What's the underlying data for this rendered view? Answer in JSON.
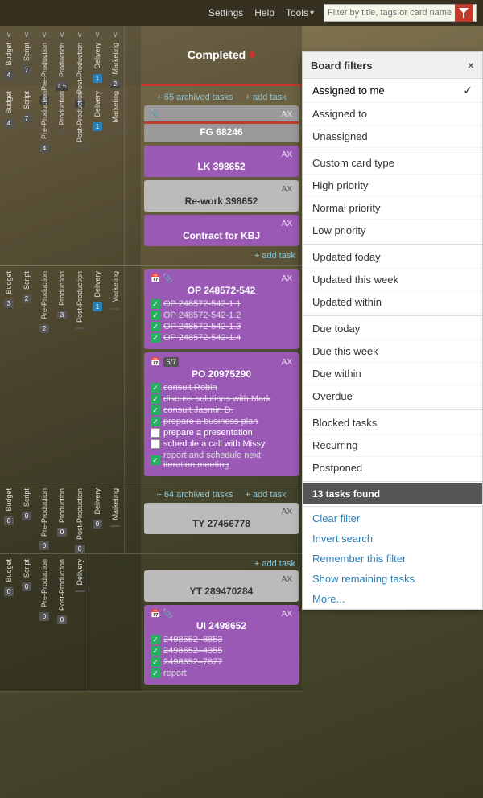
{
  "topbar": {
    "settings": "Settings",
    "help": "Help",
    "tools": "Tools",
    "tools_arrow": "▾",
    "search_placeholder": "Filter by title, tags or card name"
  },
  "board": {
    "completed_label": "Completed",
    "archived_tasks_1": "+ 65 archived tasks",
    "add_task_1": "+ add task",
    "archived_tasks_2": "+ 64 archived tasks",
    "add_task_2": "+ add task",
    "add_task_3": "+ add task",
    "cards": [
      {
        "id": "card-fg",
        "title": "FG 68246",
        "color": "grey",
        "ax": "AX",
        "has_clip": true,
        "has_red_line": true
      },
      {
        "id": "card-lk",
        "title": "LK 398652",
        "color": "purple",
        "ax": "AX"
      },
      {
        "id": "card-rework",
        "title": "Re-work 398652",
        "color": "light-grey",
        "ax": "AX"
      },
      {
        "id": "card-contract",
        "title": "Contract for KBJ",
        "color": "purple",
        "ax": "AX"
      }
    ],
    "cards2": [
      {
        "id": "card-op",
        "title": "OP 248572-542",
        "color": "purple",
        "ax": "AX",
        "has_clip": true,
        "has_calendar": true,
        "subtasks": [
          {
            "text": "OP 248572-542-1.1",
            "done": true
          },
          {
            "text": "OP 248572-542-1.2",
            "done": true
          },
          {
            "text": "OP 248572-542-1.3",
            "done": true
          },
          {
            "text": "OP 248572-542-1.4",
            "done": true
          }
        ]
      },
      {
        "id": "card-po",
        "title": "PO 20975290",
        "color": "purple",
        "ax": "AX",
        "has_calendar": true,
        "count_label": "5/7",
        "subtasks": [
          {
            "text": "consult Robin",
            "done": true
          },
          {
            "text": "discuss solutions with Mark",
            "done": true
          },
          {
            "text": "consult Jasmin D.",
            "done": true
          },
          {
            "text": "prepare a business plan",
            "done": true
          },
          {
            "text": "prepare a presentation",
            "done": false
          },
          {
            "text": "schedule a call with Missy",
            "done": false
          },
          {
            "text": "report and schedule next iteration meeting",
            "done": true
          }
        ]
      }
    ],
    "cards3": [
      {
        "id": "card-ty",
        "title": "TY 27456778",
        "color": "light-grey",
        "ax": "AX"
      }
    ],
    "cards4": [
      {
        "id": "card-yt",
        "title": "YT 289470284",
        "color": "light-grey",
        "ax": "AX"
      },
      {
        "id": "card-ui",
        "title": "UI 2498652",
        "color": "purple",
        "ax": "AX",
        "has_clip": true,
        "has_calendar": true,
        "subtasks": [
          {
            "text": "2498652–8853",
            "done": true
          },
          {
            "text": "2498652–4355",
            "done": true
          },
          {
            "text": "2498652–7877",
            "done": true
          },
          {
            "text": "report",
            "done": true
          }
        ]
      }
    ]
  },
  "left_groups": {
    "group1": {
      "cols": [
        {
          "label": "Budget",
          "badge": "4",
          "badge_type": "normal"
        },
        {
          "label": "Script",
          "badge": "7",
          "badge_type": "normal"
        },
        {
          "label": "Pre-Production",
          "badge": "4",
          "badge_type": "normal"
        },
        {
          "label": "Production",
          "badge": "4,5",
          "badge_type": "normal"
        },
        {
          "label": "Post-Production",
          "badge": "5",
          "badge_type": "normal"
        },
        {
          "label": "Delivery",
          "badge": "1",
          "badge_type": "blue"
        },
        {
          "label": "Marketing",
          "badge": "2",
          "badge_type": "normal"
        }
      ]
    },
    "group2": {
      "cols": [
        {
          "label": "Budget",
          "badge": "3",
          "badge_type": "normal"
        },
        {
          "label": "Script",
          "badge": "2",
          "badge_type": "normal"
        },
        {
          "label": "Pre-Production",
          "badge": "2",
          "badge_type": "normal"
        },
        {
          "label": "Production",
          "badge": "3",
          "badge_type": "normal"
        },
        {
          "label": "Post-Production",
          "badge": "",
          "badge_type": "normal"
        },
        {
          "label": "Delivery",
          "badge": "1",
          "badge_type": "blue"
        },
        {
          "label": "Marketing",
          "badge": "",
          "badge_type": "normal"
        }
      ]
    },
    "group3": {
      "cols": [
        {
          "label": "Budget",
          "badge": "0",
          "badge_type": "normal"
        },
        {
          "label": "Script",
          "badge": "0",
          "badge_type": "normal"
        },
        {
          "label": "Pre-Production",
          "badge": "0",
          "badge_type": "normal"
        },
        {
          "label": "Production",
          "badge": "0",
          "badge_type": "normal"
        },
        {
          "label": "Post-Production",
          "badge": "0",
          "badge_type": "normal"
        },
        {
          "label": "Delivery",
          "badge": "0",
          "badge_type": "normal"
        },
        {
          "label": "Marketing",
          "badge": "",
          "badge_type": "normal"
        }
      ]
    },
    "group4": {
      "cols": [
        {
          "label": "Budget",
          "badge": "0",
          "badge_type": "normal"
        },
        {
          "label": "Script",
          "badge": "0",
          "badge_type": "normal"
        },
        {
          "label": "Pre-Production",
          "badge": "0",
          "badge_type": "normal"
        },
        {
          "label": "Post-Production",
          "badge": "0",
          "badge_type": "normal"
        },
        {
          "label": "Delivery",
          "badge": "",
          "badge_type": "normal"
        }
      ]
    }
  },
  "filter_panel": {
    "title": "Board filters",
    "close_label": "×",
    "items": [
      {
        "label": "Assigned to me",
        "active": true,
        "check": "✓"
      },
      {
        "label": "Assigned to",
        "active": false
      },
      {
        "label": "Unassigned",
        "active": false
      },
      {
        "label": "Custom card type",
        "active": false
      },
      {
        "label": "High priority",
        "active": false
      },
      {
        "label": "Normal priority",
        "active": false
      },
      {
        "label": "Low priority",
        "active": false
      },
      {
        "label": "Updated today",
        "active": false
      },
      {
        "label": "Updated this week",
        "active": false
      },
      {
        "label": "Updated within",
        "active": false
      },
      {
        "label": "Due today",
        "active": false
      },
      {
        "label": "Due this week",
        "active": false
      },
      {
        "label": "Due within",
        "active": false
      },
      {
        "label": "Overdue",
        "active": false
      },
      {
        "label": "Blocked tasks",
        "active": false
      },
      {
        "label": "Recurring",
        "active": false
      },
      {
        "label": "Postponed",
        "active": false
      }
    ],
    "results": "13 tasks found",
    "actions": [
      {
        "label": "Clear filter"
      },
      {
        "label": "Invert search"
      },
      {
        "label": "Remember this filter"
      },
      {
        "label": "Show remaining tasks"
      },
      {
        "label": "More..."
      }
    ]
  }
}
